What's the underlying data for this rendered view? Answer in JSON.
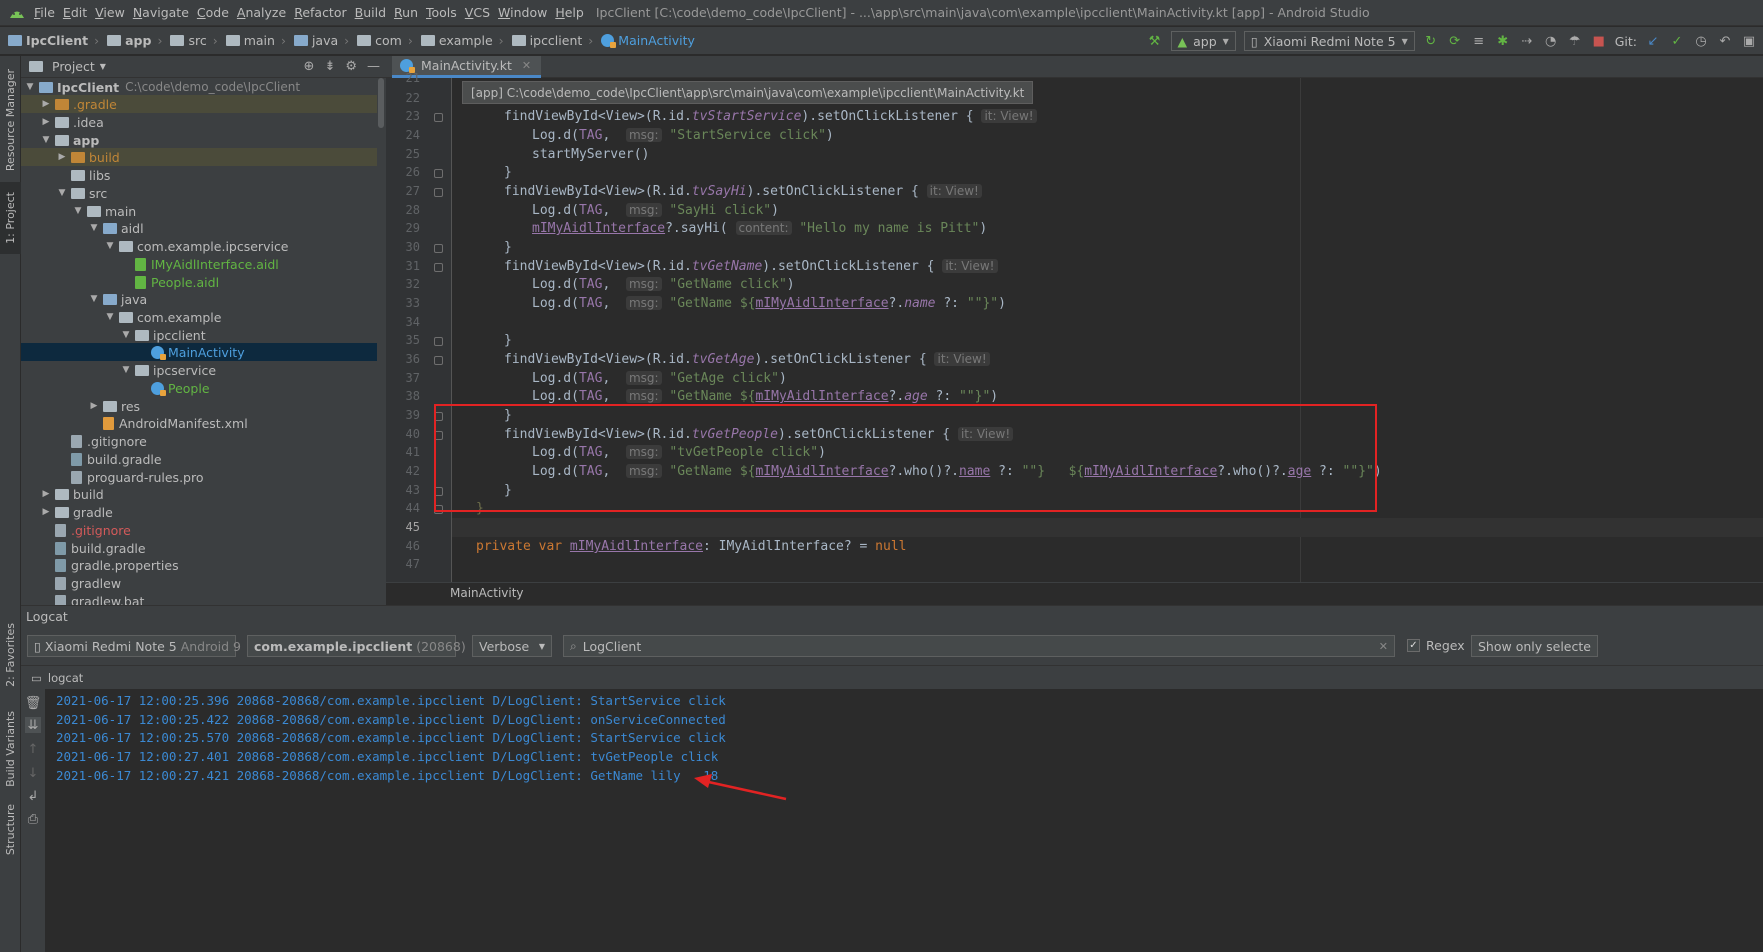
{
  "window": {
    "title": "IpcClient [C:\\code\\demo_code\\IpcClient] - ...\\app\\src\\main\\java\\com\\example\\ipcclient\\MainActivity.kt [app] - Android Studio"
  },
  "menu": [
    "File",
    "Edit",
    "View",
    "Navigate",
    "Code",
    "Analyze",
    "Refactor",
    "Build",
    "Run",
    "Tools",
    "VCS",
    "Window",
    "Help"
  ],
  "breadcrumb": [
    "IpcClient",
    "app",
    "src",
    "main",
    "java",
    "com",
    "example",
    "ipcclient",
    "MainActivity"
  ],
  "toolbar": {
    "run_config": "app",
    "device": "Xiaomi Redmi Note 5",
    "git_label": "Git:"
  },
  "left_strip": {
    "resource_manager": "Resource Manager",
    "project": "1: Project",
    "favorites": "2: Favorites",
    "build_variants": "Build Variants",
    "structure": "Structure"
  },
  "project_panel": {
    "title": "Project",
    "tree": [
      {
        "label": "IpcClient",
        "path": "C:\\code\\demo_code\\IpcClient"
      },
      {
        "label": ".gradle"
      },
      {
        "label": ".idea"
      },
      {
        "label": "app"
      },
      {
        "label": "build"
      },
      {
        "label": "libs"
      },
      {
        "label": "src"
      },
      {
        "label": "main"
      },
      {
        "label": "aidl"
      },
      {
        "label": "com.example.ipcservice"
      },
      {
        "label": "IMyAidlInterface.aidl"
      },
      {
        "label": "People.aidl"
      },
      {
        "label": "java"
      },
      {
        "label": "com.example"
      },
      {
        "label": "ipcclient"
      },
      {
        "label": "MainActivity"
      },
      {
        "label": "ipcservice"
      },
      {
        "label": "People"
      },
      {
        "label": "res"
      },
      {
        "label": "AndroidManifest.xml"
      },
      {
        "label": ".gitignore"
      },
      {
        "label": "build.gradle"
      },
      {
        "label": "proguard-rules.pro"
      },
      {
        "label": "build"
      },
      {
        "label": "gradle"
      },
      {
        "label": ".gitignore"
      },
      {
        "label": "build.gradle"
      },
      {
        "label": "gradle.properties"
      },
      {
        "label": "gradlew"
      },
      {
        "label": "gradlew.bat"
      }
    ]
  },
  "editor": {
    "tab_label": "MainActivity.kt",
    "tooltip": "[app] C:\\code\\demo_code\\IpcClient\\app\\src\\main\\java\\com\\example\\ipcclient\\MainActivity.kt",
    "footer_breadcrumb": "MainActivity",
    "line_numbers": [
      "21",
      "22",
      "23",
      "24",
      "25",
      "26",
      "27",
      "28",
      "29",
      "30",
      "31",
      "32",
      "33",
      "34",
      "35",
      "36",
      "37",
      "38",
      "39",
      "40",
      "41",
      "42",
      "43",
      "44",
      "45",
      "46",
      "47"
    ],
    "current_line": "45",
    "code": {
      "l23_a": "findViewById<View>(R.id.",
      "l23_id": "tvStartService",
      "l23_b": ").setOnClickListener {",
      "hint_it": "it: View!",
      "log_d": "Log.d(",
      "tag": "TAG",
      "comma": ", ",
      "hint_msg": "msg:",
      "s_start": "\"StartService click\"",
      "close_paren": ")",
      "l25": "startMyServer()",
      "brace": "}",
      "l27_id": "tvSayHi",
      "s_sayhi": "\"SayHi click\"",
      "aidl_ref": "mIMyAidlInterface",
      "l29_b": "?.sayHi(",
      "hint_content": "content:",
      "s_pitt": "\"Hello my name is Pitt\"",
      "l31_id": "tvGetName",
      "s_getname_click": "\"GetName click\"",
      "s_getname": "\"GetName ${",
      "name_prop": "name",
      "elvis": " ?: ",
      "empty_str": "\"\"",
      "close_tpl": "}\"",
      "l36_id": "tvGetAge",
      "s_getage_click": "\"GetAge click\"",
      "age_prop": "age",
      "l40_id": "tvGetPeople",
      "s_getpeople_click": "\"tvGetPeople click\"",
      "who": "?.who()?.",
      "dot": "?.",
      "l46_kw": "private var ",
      "l46_type": ": IMyAidlInterface? = ",
      "l46_null": "null"
    }
  },
  "logcat": {
    "title": "Logcat",
    "device": "Xiaomi Redmi Note 5",
    "device_os": "Android 9",
    "process": "com.example.ipcclient",
    "process_pid": "(20868)",
    "level": "Verbose",
    "search": "LogClient",
    "regex_label": "Regex",
    "regex_checked": true,
    "show_only_selected": "Show only selecte",
    "sub_title": "logcat",
    "lines": [
      "2021-06-17 12:00:25.396 20868-20868/com.example.ipcclient D/LogClient: StartService click",
      "2021-06-17 12:00:25.422 20868-20868/com.example.ipcclient D/LogClient: onServiceConnected",
      "2021-06-17 12:00:25.570 20868-20868/com.example.ipcclient D/LogClient: StartService click",
      "2021-06-17 12:00:27.401 20868-20868/com.example.ipcclient D/LogClient: tvGetPeople click",
      "2021-06-17 12:00:27.421 20868-20868/com.example.ipcclient D/LogClient: GetName lily   18"
    ]
  },
  "colors": {
    "accent_blue": "#4a88c7",
    "annotation_red": "#e22323",
    "log_blue": "#3b89d3"
  }
}
